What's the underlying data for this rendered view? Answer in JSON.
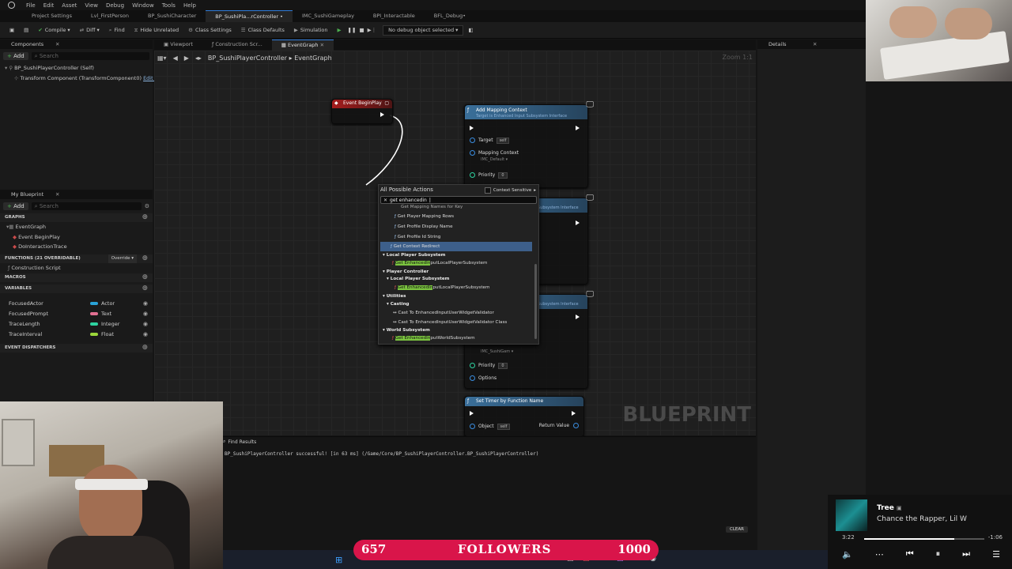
{
  "menubar": {
    "items": [
      "File",
      "Edit",
      "Asset",
      "View",
      "Debug",
      "Window",
      "Tools",
      "Help"
    ]
  },
  "tabs": [
    {
      "label": "Project Settings",
      "active": false
    },
    {
      "label": "Lvl_FirstPerson",
      "active": false
    },
    {
      "label": "BP_SushiCharacter",
      "active": false
    },
    {
      "label": "BP_SushiPla...rController •",
      "active": true
    },
    {
      "label": "IMC_SushiGameplay",
      "active": false
    },
    {
      "label": "BPI_Interactable",
      "active": false
    },
    {
      "label": "BFL_Debug•",
      "active": false
    }
  ],
  "toolbar": {
    "compile": "Compile",
    "diff": "Diff",
    "find": "Find",
    "hide_unrelated": "Hide Unrelated",
    "class_settings": "Class Settings",
    "class_defaults": "Class Defaults",
    "simulation": "Simulation",
    "debug_object": "No debug object selected"
  },
  "components": {
    "title": "Components",
    "add": "Add",
    "search_placeholder": "Search",
    "root": "BP_SushiPlayerController (Self)",
    "child": "Transform Component (TransformComponent0)",
    "edit_link": "Edit in C++"
  },
  "mybp": {
    "title": "My Blueprint",
    "add": "Add",
    "search_placeholder": "Search",
    "graphs_header": "GRAPHS",
    "graph_items": [
      "EventGraph",
      "Event BeginPlay",
      "DoInteractionTrace"
    ],
    "functions_header": "FUNCTIONS (21 OVERRIDABLE)",
    "override": "Override",
    "function_items": [
      "Construction Script"
    ],
    "macros_header": "MACROS",
    "variables_header": "VARIABLES",
    "variables": [
      {
        "name": "FocusedActor",
        "type": "Actor",
        "color": "#2aa2d6"
      },
      {
        "name": "FocusedPrompt",
        "type": "Text",
        "color": "#e27092"
      },
      {
        "name": "TraceLength",
        "type": "Integer",
        "color": "#2ed3a0"
      },
      {
        "name": "TraceInterval",
        "type": "Float",
        "color": "#9cd63a"
      }
    ],
    "dispatchers_header": "EVENT DISPATCHERS"
  },
  "graph_tabs": {
    "viewport": "Viewport",
    "construction": "Construction Scr...",
    "eventgraph": "EventGraph"
  },
  "breadcrumb": {
    "root": "BP_SushiPlayerController",
    "current": "EventGraph",
    "zoom": "Zoom 1:1"
  },
  "details": {
    "title": "Details"
  },
  "nodes": {
    "begin_play": "Event BeginPlay",
    "add_mapping": {
      "title": "Add Mapping Context",
      "subtitle": "Target is Enhanced Input Subsystem Interface",
      "target": "Target",
      "self": "self",
      "mapping_context": "Mapping Context",
      "mapping_value": "IMC_Default",
      "priority": "Priority",
      "priority_value": "0"
    },
    "node2_subtitle": "Subsystem Interface",
    "node3_subtitle": "Subsystem Interface",
    "node3_mapping_value": "IMC_SushiGam",
    "node3_priority": "Priority",
    "node3_priority_value": "0",
    "node3_options": "Options",
    "set_timer": {
      "title": "Set Timer by Function Name",
      "object": "Object",
      "self": "self",
      "return_value": "Return Value"
    },
    "watermark": "BLUEPRINT"
  },
  "action_menu": {
    "title": "All Possible Actions",
    "context_sensitive": "Context Sensitive",
    "search_value": "get enhancedin",
    "items": [
      {
        "kind": "fn",
        "text": "Get Mapping Names for Key"
      },
      {
        "kind": "fn",
        "text": "Get Player Mapping Rows"
      },
      {
        "kind": "fn",
        "text": "Get Profile Display Name"
      },
      {
        "kind": "fn",
        "text": "Get Profile Id String"
      },
      {
        "kind": "fn-selected",
        "text": "Get Context Redirect"
      },
      {
        "kind": "cat",
        "text": "Local Player Subsystem"
      },
      {
        "kind": "fn-hl",
        "hl": "Get EnhancedIn",
        "rest": "putLocalPlayerSubsystem"
      },
      {
        "kind": "cat",
        "text": "Player Controller"
      },
      {
        "kind": "subcat",
        "text": "Local Player Subsystem"
      },
      {
        "kind": "fn-hl2",
        "hl": "Get EnhancedIn",
        "rest": "putLocalPlayerSubsystem"
      },
      {
        "kind": "subcat",
        "text": "Utilities"
      },
      {
        "kind": "subcat2",
        "text": "Casting"
      },
      {
        "kind": "cast",
        "text": "Cast To EnhancedInputUserWidgetValidator"
      },
      {
        "kind": "cast",
        "text": "Cast To EnhancedInputUserWidgetValidator Class"
      },
      {
        "kind": "cat",
        "text": "World Subsystem"
      },
      {
        "kind": "fn-hl",
        "hl": "Get EnhancedIn",
        "rest": "putWorldSubsystem"
      }
    ]
  },
  "output": {
    "title": "Find Results",
    "message": "BP_SushiPlayerController successful! [in 63 ms] (/Game/Core/BP_SushiPlayerController.BP_SushiPlayerController)",
    "clear": "CLEAR"
  },
  "followers": {
    "current": "657",
    "label": "FOLLOWERS",
    "goal": "1000",
    "accent": "#d9154a"
  },
  "spotify": {
    "title": "Tree",
    "artist": "Chance the Rapper, Lil W",
    "elapsed": "3:22",
    "remaining": "-1:06",
    "progress": 0.75
  }
}
